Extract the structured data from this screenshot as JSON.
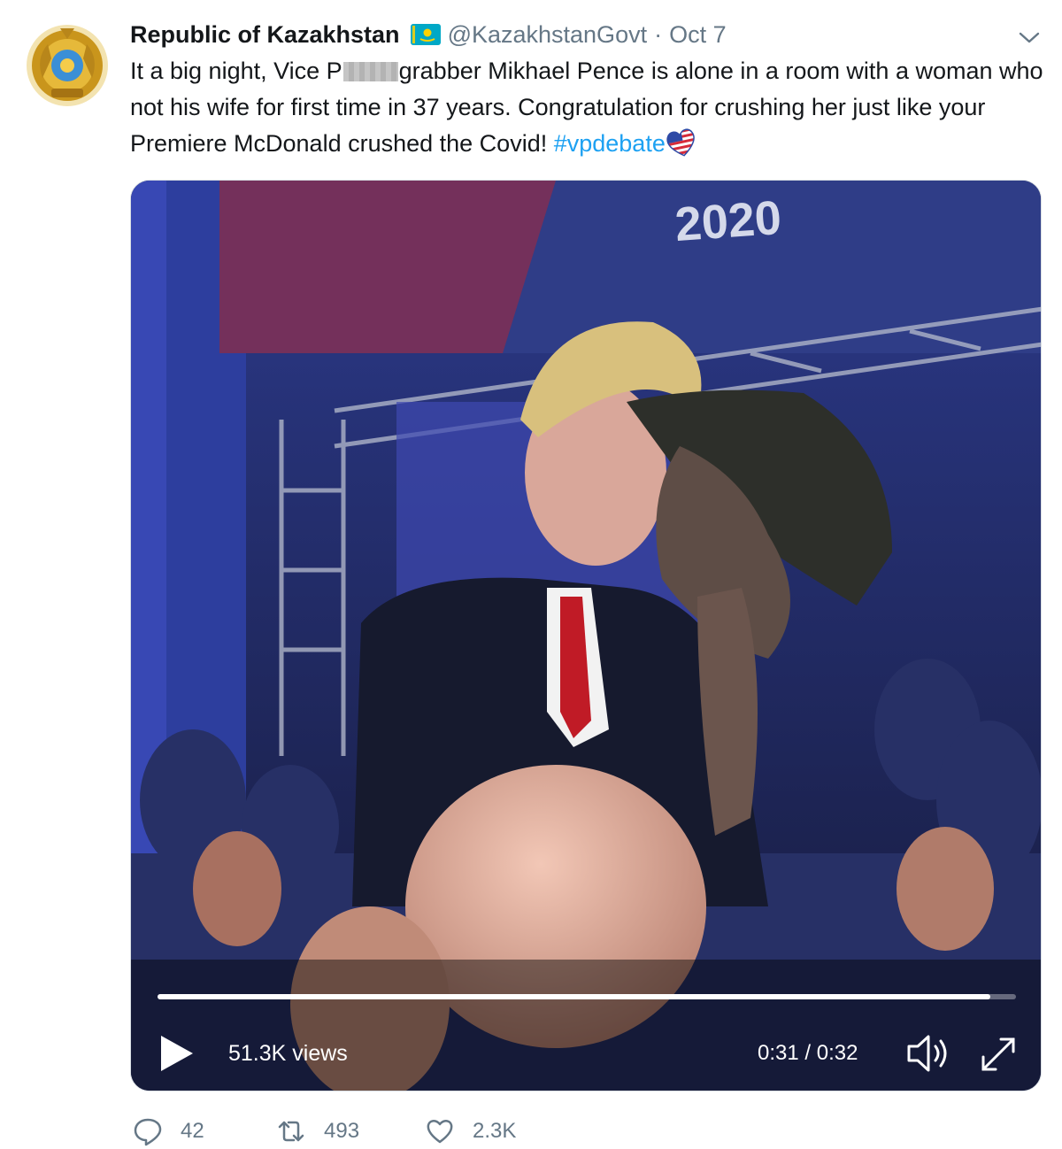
{
  "colors": {
    "link": "#1da1f2",
    "secondary_text": "#657786",
    "primary_text": "#14171a"
  },
  "tweet": {
    "display_name": "Republic of Kazakhstan",
    "flag_icon": "kazakhstan-flag-emoji",
    "handle": "@KazakhstanGovt",
    "separator": "·",
    "date": "Oct 7",
    "text_part1": "It a big night, Vice P",
    "text_part2": "grabber Mikhael Pence is alone in a room with a woman who not his wife for first time in 37 years. Congratulation for crushing her just like your Premiere McDonald crushed the Covid! ",
    "hashtag": "#vpdebate",
    "hashtag_emoji": "us-flag-heart-emoji"
  },
  "video": {
    "banner_text": "2020",
    "views": "51.3K views",
    "time": "0:31 / 0:32",
    "progress": 0.97,
    "play_icon": "play-icon",
    "volume_icon": "volume-icon",
    "expand_icon": "expand-icon"
  },
  "actions": {
    "reply_count": "42",
    "retweet_count": "493",
    "like_count": "2.3K"
  }
}
